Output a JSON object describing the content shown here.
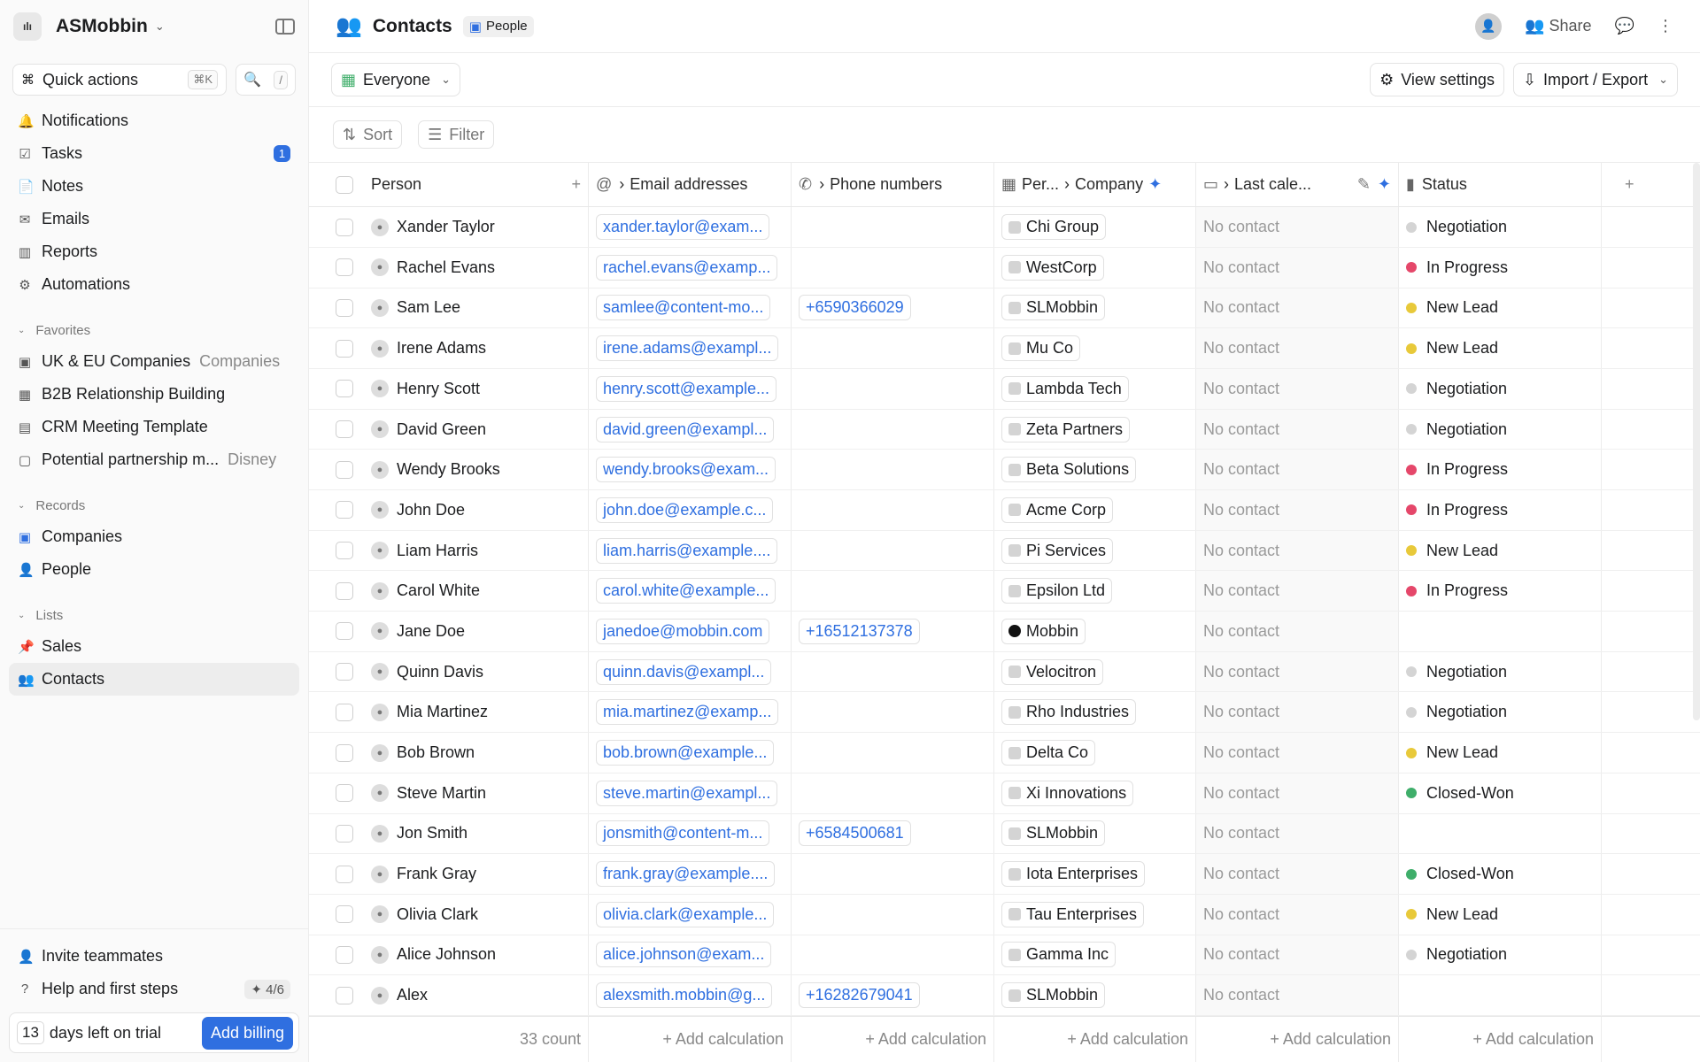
{
  "workspace": {
    "logo": "ılı",
    "name": "ASMobbin"
  },
  "quick": {
    "label": "Quick actions",
    "kbd": "⌘K",
    "search_kbd": "/"
  },
  "nav": [
    {
      "label": "Notifications",
      "icon": "🔔",
      "name": "nav-notifications"
    },
    {
      "label": "Tasks",
      "icon": "☑",
      "name": "nav-tasks",
      "badge": "1"
    },
    {
      "label": "Notes",
      "icon": "📄",
      "name": "nav-notes"
    },
    {
      "label": "Emails",
      "icon": "✉",
      "name": "nav-emails"
    },
    {
      "label": "Reports",
      "icon": "▥",
      "name": "nav-reports"
    },
    {
      "label": "Automations",
      "icon": "⚙",
      "name": "nav-automations"
    }
  ],
  "favorites": {
    "title": "Favorites",
    "items": [
      {
        "label": "UK & EU Companies",
        "sub": "Companies",
        "icon": "▣"
      },
      {
        "label": "B2B Relationship Building",
        "sub": "",
        "icon": "▦"
      },
      {
        "label": "CRM Meeting Template",
        "sub": "",
        "icon": "▤"
      },
      {
        "label": "Potential partnership m...",
        "sub": "Disney",
        "icon": "▢"
      }
    ]
  },
  "records": {
    "title": "Records",
    "items": [
      {
        "label": "Companies",
        "icon": "▣"
      },
      {
        "label": "People",
        "icon": "👤"
      }
    ]
  },
  "lists": {
    "title": "Lists",
    "items": [
      {
        "label": "Sales",
        "icon": "📌"
      },
      {
        "label": "Contacts",
        "icon": "👥"
      }
    ]
  },
  "footer": {
    "invite": "Invite teammates",
    "help": "Help and first steps",
    "steps": "4/6",
    "trial_days": "13",
    "trial_text": "days left on trial",
    "billing": "Add billing"
  },
  "header": {
    "title": "Contacts",
    "chip": "People",
    "share": "Share"
  },
  "view": {
    "name": "Everyone",
    "settings": "View settings",
    "import": "Import / Export"
  },
  "filters": {
    "sort": "Sort",
    "filter": "Filter"
  },
  "columns": {
    "person": "Person",
    "email": "Email addresses",
    "phone": "Phone numbers",
    "company_pre": "Per...",
    "company": "Company",
    "lastcal": "Last cale...",
    "status": "Status"
  },
  "rows": [
    {
      "name": "Xander Taylor",
      "email": "xander.taylor@exam...",
      "phone": "",
      "company": "Chi Group",
      "last": "No contact",
      "status": "Negotiation"
    },
    {
      "name": "Rachel Evans",
      "email": "rachel.evans@examp...",
      "phone": "",
      "company": "WestCorp",
      "last": "No contact",
      "status": "In Progress"
    },
    {
      "name": "Sam Lee",
      "email": "samlee@content-mo...",
      "phone": "+6590366029",
      "company": "SLMobbin",
      "last": "No contact",
      "status": "New Lead"
    },
    {
      "name": "Irene Adams",
      "email": "irene.adams@exampl...",
      "phone": "",
      "company": "Mu Co",
      "last": "No contact",
      "status": "New Lead"
    },
    {
      "name": "Henry Scott",
      "email": "henry.scott@example...",
      "phone": "",
      "company": "Lambda Tech",
      "last": "No contact",
      "status": "Negotiation"
    },
    {
      "name": "David Green",
      "email": "david.green@exampl...",
      "phone": "",
      "company": "Zeta Partners",
      "last": "No contact",
      "status": "Negotiation"
    },
    {
      "name": "Wendy Brooks",
      "email": "wendy.brooks@exam...",
      "phone": "",
      "company": "Beta Solutions",
      "last": "No contact",
      "status": "In Progress"
    },
    {
      "name": "John Doe",
      "email": "john.doe@example.c...",
      "phone": "",
      "company": "Acme Corp",
      "last": "No contact",
      "status": "In Progress"
    },
    {
      "name": "Liam Harris",
      "email": "liam.harris@example....",
      "phone": "",
      "company": "Pi Services",
      "last": "No contact",
      "status": "New Lead"
    },
    {
      "name": "Carol White",
      "email": "carol.white@example...",
      "phone": "",
      "company": "Epsilon Ltd",
      "last": "No contact",
      "status": "In Progress"
    },
    {
      "name": "Jane Doe",
      "email": "janedoe@mobbin.com",
      "phone": "+16512137378",
      "company": "Mobbin",
      "last": "No contact",
      "status": ""
    },
    {
      "name": "Quinn Davis",
      "email": "quinn.davis@exampl...",
      "phone": "",
      "company": "Velocitron",
      "last": "No contact",
      "status": "Negotiation"
    },
    {
      "name": "Mia Martinez",
      "email": "mia.martinez@examp...",
      "phone": "",
      "company": "Rho Industries",
      "last": "No contact",
      "status": "Negotiation"
    },
    {
      "name": "Bob Brown",
      "email": "bob.brown@example...",
      "phone": "",
      "company": "Delta Co",
      "last": "No contact",
      "status": "New Lead"
    },
    {
      "name": "Steve Martin",
      "email": "steve.martin@exampl...",
      "phone": "",
      "company": "Xi Innovations",
      "last": "No contact",
      "status": "Closed-Won"
    },
    {
      "name": "Jon Smith",
      "email": "jonsmith@content-m...",
      "phone": "+6584500681",
      "company": "SLMobbin",
      "last": "No contact",
      "status": ""
    },
    {
      "name": "Frank Gray",
      "email": "frank.gray@example....",
      "phone": "",
      "company": "Iota Enterprises",
      "last": "No contact",
      "status": "Closed-Won"
    },
    {
      "name": "Olivia Clark",
      "email": "olivia.clark@example...",
      "phone": "",
      "company": "Tau Enterprises",
      "last": "No contact",
      "status": "New Lead"
    },
    {
      "name": "Alice Johnson",
      "email": "alice.johnson@exam...",
      "phone": "",
      "company": "Gamma Inc",
      "last": "No contact",
      "status": "Negotiation"
    },
    {
      "name": "Alex",
      "email": "alexsmith.mobbin@g...",
      "phone": "+16282679041",
      "company": "SLMobbin",
      "last": "No contact",
      "status": ""
    }
  ],
  "status_colors": {
    "Negotiation": "#d4d4d4",
    "In Progress": "#e5476a",
    "New Lead": "#e8c93a",
    "Closed-Won": "#3fae6a"
  },
  "tfoot": {
    "count": "33 count",
    "calc": "+ Add calculation"
  }
}
